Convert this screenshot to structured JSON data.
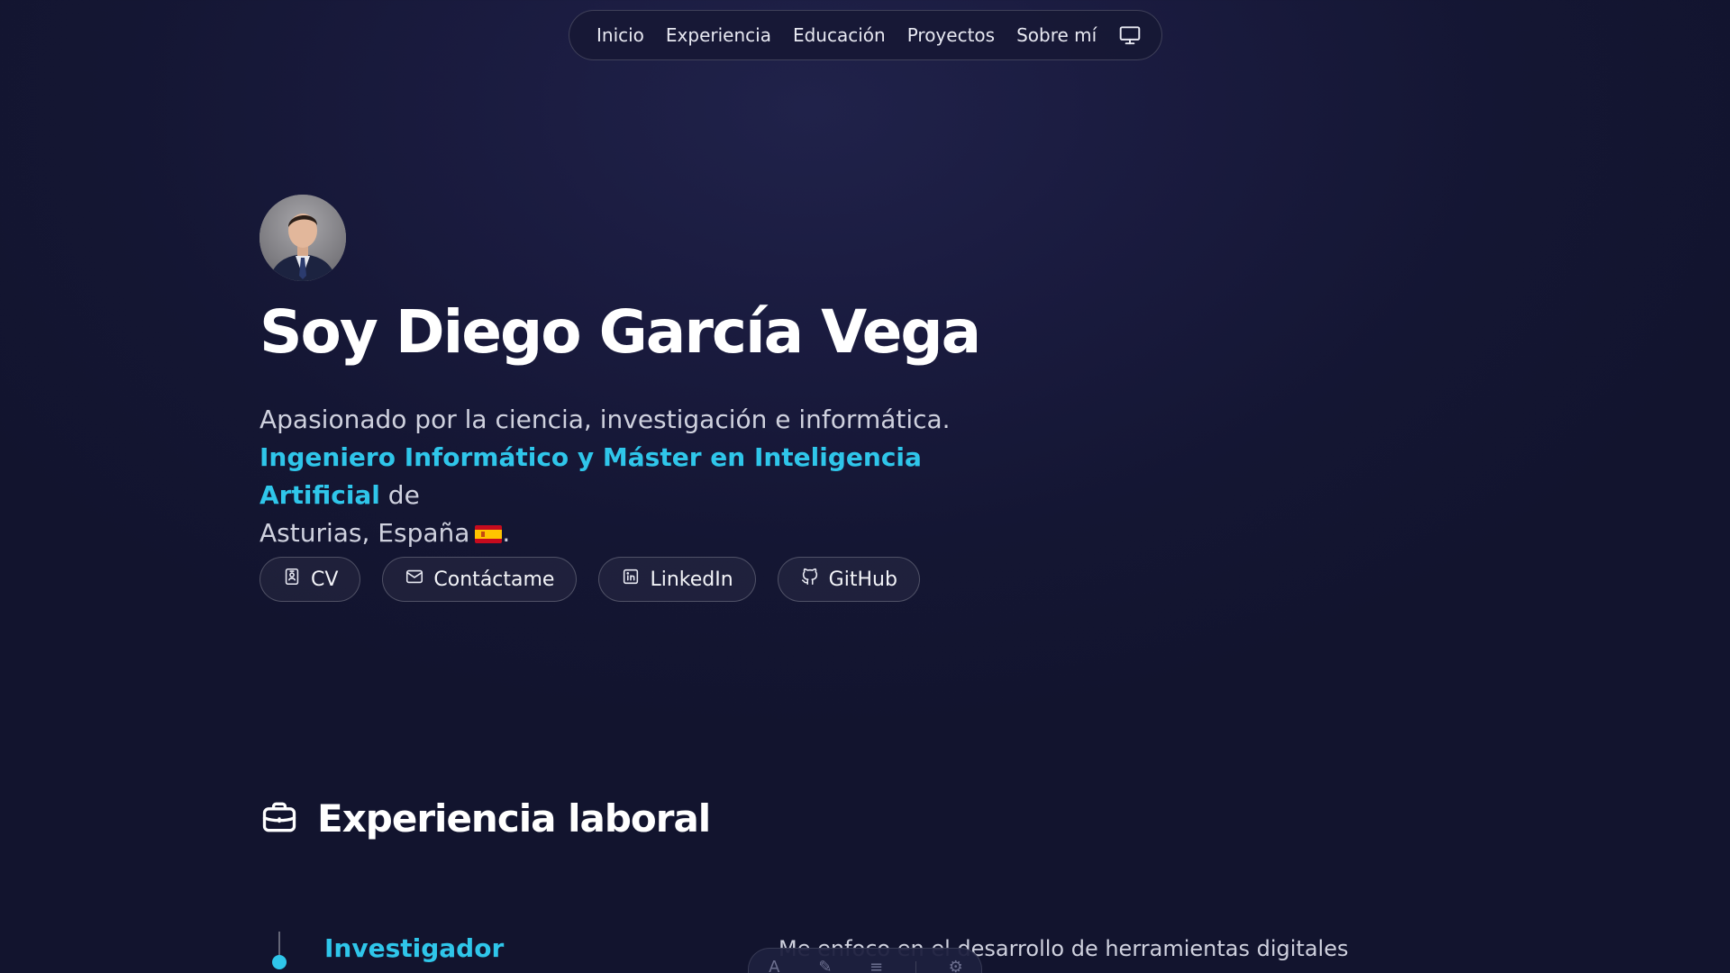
{
  "nav": {
    "items": [
      "Inicio",
      "Experiencia",
      "Educación",
      "Proyectos",
      "Sobre mí"
    ],
    "theme_icon": "monitor-icon"
  },
  "hero": {
    "name": "Soy Diego García Vega",
    "line1": "Apasionado por la ciencia, investigación e informática.",
    "highlight": "Ingeniero Informático y Máster en Inteligencia Artificial",
    "line2_tail": " de",
    "line3": "Asturias, España",
    "line3_end": ".",
    "flag_icon": "spain-flag-icon"
  },
  "buttons": [
    {
      "label": "CV",
      "icon": "document-icon"
    },
    {
      "label": "Contáctame",
      "icon": "mail-icon"
    },
    {
      "label": "LinkedIn",
      "icon": "linkedin-icon"
    },
    {
      "label": "GitHub",
      "icon": "github-icon"
    }
  ],
  "experience": {
    "section_title": "Experiencia laboral",
    "section_icon": "briefcase-icon",
    "role": "Investigador",
    "description": "Me enfoco en el desarrollo de herramientas digitales"
  },
  "colors": {
    "accent": "#2fc6ea",
    "background": "#16183a",
    "text": "#ffffff"
  }
}
